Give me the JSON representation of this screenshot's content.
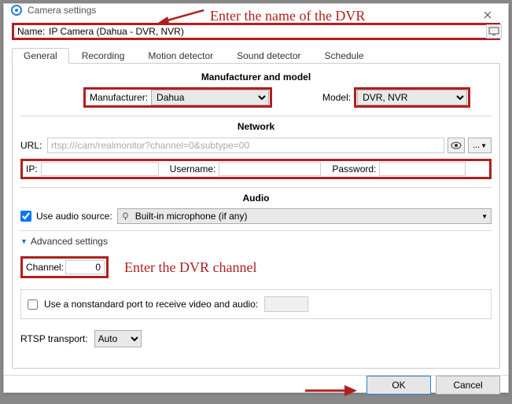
{
  "window": {
    "title": "Camera settings"
  },
  "annotations": {
    "top": "Enter the name of the DVR",
    "channel": "Enter the DVR channel"
  },
  "name": {
    "label": "Name:",
    "value": "IP Camera (Dahua - DVR, NVR)"
  },
  "tabs": {
    "general": "General",
    "recording": "Recording",
    "motion": "Motion detector",
    "sound": "Sound detector",
    "schedule": "Schedule"
  },
  "sections": {
    "mfg_model": "Manufacturer and model",
    "network": "Network",
    "audio": "Audio"
  },
  "manufacturer": {
    "label": "Manufacturer:",
    "value": "Dahua"
  },
  "model": {
    "label": "Model:",
    "value": "DVR, NVR"
  },
  "url": {
    "label": "URL:",
    "value": "rtsp:///cam/realmonitor?channel=0&subtype=00",
    "more_btn": "..."
  },
  "credentials": {
    "ip_label": "IP:",
    "ip_value": "",
    "user_label": "Username:",
    "user_value": "",
    "pass_label": "Password:",
    "pass_value": ""
  },
  "audio": {
    "checkbox_label": "Use audio source:",
    "combo": "Built-in microphone (if any)"
  },
  "advanced": {
    "label": "Advanced settings"
  },
  "channel": {
    "label": "Channel:",
    "value": "0"
  },
  "nonstd": {
    "label": "Use a nonstandard port to receive video and audio:",
    "port": ""
  },
  "rtsp": {
    "label": "RTSP transport:",
    "value": "Auto"
  },
  "footer": {
    "ok": "OK",
    "cancel": "Cancel"
  }
}
